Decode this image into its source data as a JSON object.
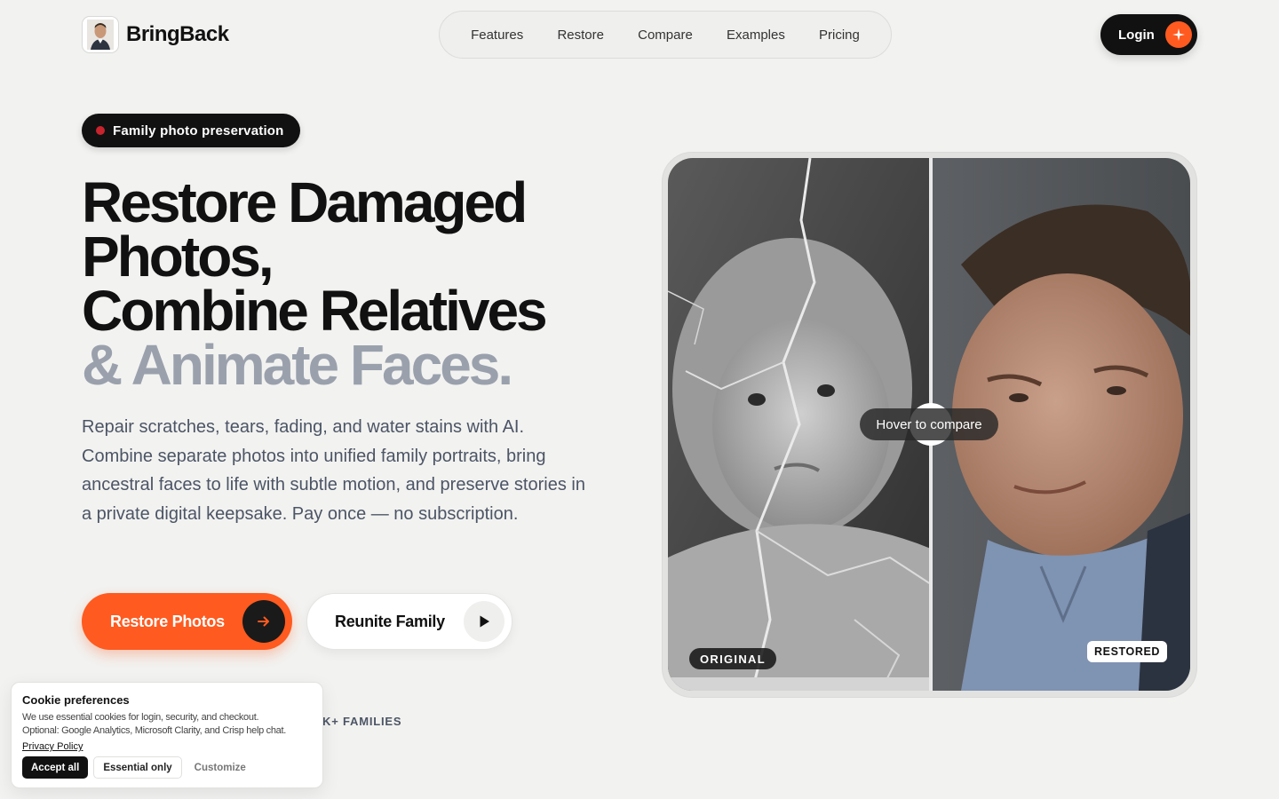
{
  "brand": {
    "name": "BringBack"
  },
  "nav": {
    "items": [
      "Features",
      "Restore",
      "Compare",
      "Examples",
      "Pricing"
    ]
  },
  "header": {
    "login_label": "Login"
  },
  "hero": {
    "pill": "Family photo preservation",
    "headline": [
      "Restore Damaged",
      "Photos,",
      "Combine Relatives",
      "& Animate Faces."
    ],
    "lead": "Repair scratches, tears, fading, and water stains with AI. Combine separate photos into unified family portraits, bring ancestral faces to life with subtle motion, and preserve stories in a private digital keepsake. Pay once — no subscription.",
    "primary_cta": "Restore Photos",
    "secondary_cta": "Reunite Family",
    "social_proof": "K+ FAMILIES"
  },
  "compare": {
    "hover_label": "Hover to compare",
    "original_badge": "ORIGINAL",
    "restored_badge": "RESTORED",
    "slider_position_pct": 50
  },
  "cookie": {
    "title": "Cookie preferences",
    "line1": "We use essential cookies for login, security, and checkout.",
    "line2": "Optional: Google Analytics, Microsoft Clarity, and Crisp help chat.",
    "privacy_link": "Privacy Policy",
    "accept_all": "Accept all",
    "essential_only": "Essential only",
    "customize": "Customize"
  },
  "colors": {
    "accent": "#ff5a1f",
    "dark": "#111111",
    "muted_headline": "#9aa1ad",
    "background": "#f2f2f0"
  },
  "icons": [
    "logo-portrait-icon",
    "sparkle-icon",
    "red-dot-icon",
    "arrow-right-icon",
    "play-icon"
  ]
}
